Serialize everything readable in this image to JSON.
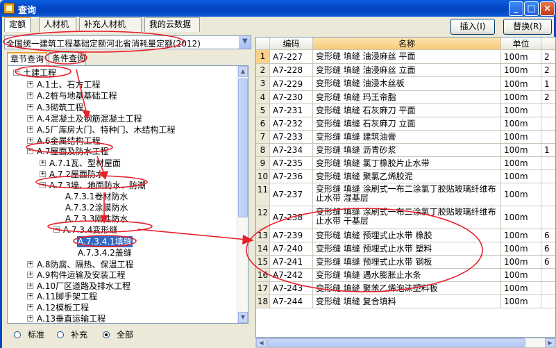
{
  "window": {
    "title": "查询"
  },
  "top_tabs": [
    "定额",
    "人材机",
    "补充人材机",
    "我的云数据"
  ],
  "buttons": {
    "insert": "插入(I)",
    "replace": "替换(R)"
  },
  "combo": {
    "value": "全国统一建筑工程基础定额河北省消耗量定额(2012)"
  },
  "sub_tabs": [
    "章节查询",
    "条件查询"
  ],
  "tree": [
    {
      "label": "土建工程",
      "exp": "−"
    },
    {
      "label": "A.1土、石方工程",
      "exp": "+"
    },
    {
      "label": "A.2桩与地基基础工程",
      "exp": "+"
    },
    {
      "label": "A.3砌筑工程",
      "exp": "+"
    },
    {
      "label": "A.4混凝土及钢筋混凝土工程",
      "exp": "+"
    },
    {
      "label": "A.5厂库房大门、特种门、木结构工程",
      "exp": "+"
    },
    {
      "label": "A.6金属结构工程",
      "exp": "+"
    },
    {
      "label": "A.7屋面及防水工程",
      "exp": "−"
    },
    {
      "label": "A.7.1瓦、型材屋面",
      "exp": "+"
    },
    {
      "label": "A.7.2屋面防水",
      "exp": "+"
    },
    {
      "label": "A.7.3墙、地面防水、防潮",
      "exp": "−"
    },
    {
      "label": "A.7.3.1卷材防水",
      "exp": ""
    },
    {
      "label": "A.7.3.2涂膜防水",
      "exp": ""
    },
    {
      "label": "A.7.3.3刚性防水",
      "exp": ""
    },
    {
      "label": "A.7.3.4变形缝",
      "exp": "−"
    },
    {
      "label": "A.7.3.4.1填缝",
      "exp": ""
    },
    {
      "label": "A.7.3.4.2盖缝",
      "exp": ""
    },
    {
      "label": "A.8防腐、隔热、保温工程",
      "exp": "+"
    },
    {
      "label": "A.9构件运输及安装工程",
      "exp": "+"
    },
    {
      "label": "A.10厂区道路及排水工程",
      "exp": "+"
    },
    {
      "label": "A.11脚手架工程",
      "exp": "+"
    },
    {
      "label": "A.12模板工程",
      "exp": "+"
    },
    {
      "label": "A.13垂直运输工程",
      "exp": "+"
    }
  ],
  "filter": {
    "options": [
      "标准",
      "补充",
      "全部"
    ],
    "selected": "全部"
  },
  "grid": {
    "headers": [
      "",
      "编码",
      "名称",
      "单位",
      ""
    ],
    "rows": [
      {
        "n": "1",
        "code": "A7-227",
        "name": "变形缝 填缝 油浸麻丝 平面",
        "unit": "100m",
        "extra": "2"
      },
      {
        "n": "2",
        "code": "A7-228",
        "name": "变形缝 填缝 油浸麻丝 立面",
        "unit": "100m",
        "extra": "2"
      },
      {
        "n": "3",
        "code": "A7-229",
        "name": "变形缝 填缝 油浸木丝板",
        "unit": "100m",
        "extra": "1"
      },
      {
        "n": "4",
        "code": "A7-230",
        "name": "变形缝 填缝 玛王帝脂",
        "unit": "100m",
        "extra": "2"
      },
      {
        "n": "5",
        "code": "A7-231",
        "name": "变形缝 填缝 石灰麻刀 平面",
        "unit": "100m",
        "extra": ""
      },
      {
        "n": "6",
        "code": "A7-232",
        "name": "变形缝 填缝 石灰麻刀 立面",
        "unit": "100m",
        "extra": ""
      },
      {
        "n": "7",
        "code": "A7-233",
        "name": "变形缝 填缝 建筑油膏",
        "unit": "100m",
        "extra": ""
      },
      {
        "n": "8",
        "code": "A7-234",
        "name": "变形缝 填缝 沥青砂浆",
        "unit": "100m",
        "extra": "1"
      },
      {
        "n": "9",
        "code": "A7-235",
        "name": "变形缝 填缝 氯丁橡胶片止水带",
        "unit": "100m",
        "extra": ""
      },
      {
        "n": "10",
        "code": "A7-236",
        "name": "变形缝 填缝 聚氯乙烯胶泥",
        "unit": "100m",
        "extra": ""
      },
      {
        "n": "11",
        "code": "A7-237",
        "name": "变形缝 填缝 涂刷式一布二涂氯丁胶贴玻璃纤维布止水带 湿基层",
        "unit": "100m",
        "extra": ""
      },
      {
        "n": "12",
        "code": "A7-238",
        "name": "变形缝 填缝 涂刷式一布二涂氯丁胶贴玻璃纤维布止水带 干基层",
        "unit": "100m",
        "extra": ""
      },
      {
        "n": "13",
        "code": "A7-239",
        "name": "变形缝 填缝 预埋式止水带 橡胶",
        "unit": "100m",
        "extra": "6"
      },
      {
        "n": "14",
        "code": "A7-240",
        "name": "变形缝 填缝 预埋式止水带 塑料",
        "unit": "100m",
        "extra": "6"
      },
      {
        "n": "15",
        "code": "A7-241",
        "name": "变形缝 填缝 预埋式止水带 钢板",
        "unit": "100m",
        "extra": "6"
      },
      {
        "n": "16",
        "code": "A7-242",
        "name": "变形缝 填缝 遇水膨胀止水条",
        "unit": "100m",
        "extra": ""
      },
      {
        "n": "17",
        "code": "A7-243",
        "name": "变形缝 填缝 聚苯乙烯泡沫塑料板",
        "unit": "100m",
        "extra": ""
      },
      {
        "n": "18",
        "code": "A7-244",
        "name": "变形缝 填缝 复合填料",
        "unit": "100m",
        "extra": ""
      }
    ]
  },
  "colors": {
    "annotation": "#e8202a",
    "selection": "#316ac5",
    "accent": "#0447c8"
  }
}
